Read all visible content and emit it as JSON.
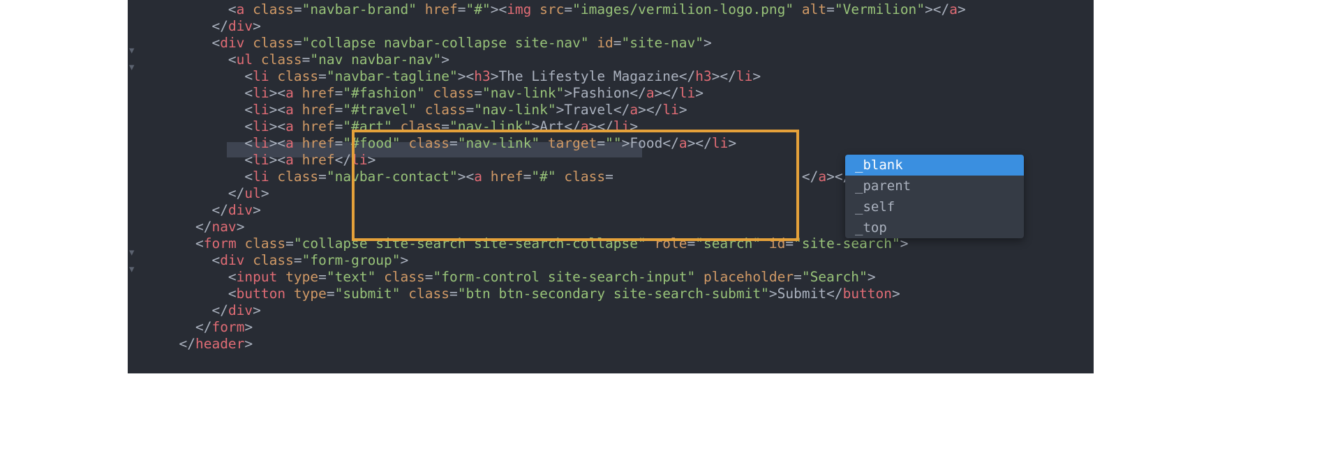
{
  "suggestions": [
    "_blank",
    "_parent",
    "_self",
    "_top"
  ],
  "selected_index": 0,
  "code": {
    "img_src": "images/vermilion-logo.png",
    "img_alt": "Vermilion",
    "div2_class": "collapse navbar-collapse site-nav",
    "div2_id": "site-nav",
    "ul_class": "nav navbar-nav",
    "tagline_class": "navbar-tagline",
    "tagline_text": "The Lifestyle Magazine",
    "fashion_href": "#fashion",
    "nav_link_class": "nav-link",
    "fashion_text": "Fashion",
    "travel_href": "#travel",
    "travel_text": "Travel",
    "art_href": "#art",
    "art_text": "Art",
    "food_href": "#food",
    "food_target": "",
    "food_text": "Food",
    "contact_class": "navbar-contact",
    "form_class": "collapse site-search site-search-collapse",
    "form_role": "search",
    "form_id": "site-search",
    "formgroup_class": "form-group",
    "input_type": "text",
    "input_class": "form-control site-search-input",
    "input_placeholder": "Search",
    "button_type": "submit",
    "button_class": "btn btn-secondary site-search-submit",
    "button_text": "Submit"
  }
}
